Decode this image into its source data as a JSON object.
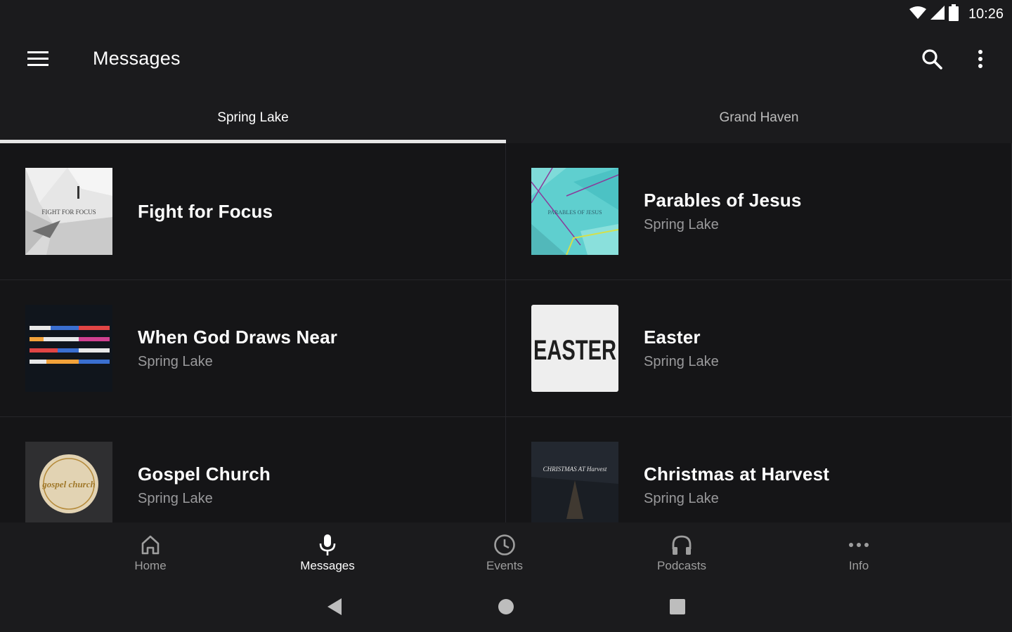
{
  "status_bar": {
    "time": "10:26"
  },
  "app_bar": {
    "title": "Messages"
  },
  "tabs": [
    {
      "label": "Spring Lake",
      "active": true
    },
    {
      "label": "Grand Haven",
      "active": false
    }
  ],
  "series": [
    {
      "title": "Fight for Focus",
      "subtitle": "",
      "art_text": "FIGHT FOR FOCUS"
    },
    {
      "title": "Parables of Jesus",
      "subtitle": "Spring Lake",
      "art_text": "PARABLES OF JESUS"
    },
    {
      "title": "When God Draws Near",
      "subtitle": "Spring Lake"
    },
    {
      "title": "Easter",
      "subtitle": "Spring Lake",
      "art_text": "EASTER"
    },
    {
      "title": "Gospel Church",
      "subtitle": "Spring Lake",
      "art_text": "gospel church"
    },
    {
      "title": "Christmas at Harvest",
      "subtitle": "Spring Lake",
      "art_text": "CHRISTMAS AT Harvest"
    }
  ],
  "bottom_nav": [
    {
      "label": "Home",
      "icon": "home-icon",
      "active": false
    },
    {
      "label": "Messages",
      "icon": "microphone-icon",
      "active": true
    },
    {
      "label": "Events",
      "icon": "clock-icon",
      "active": false
    },
    {
      "label": "Podcasts",
      "icon": "headphones-icon",
      "active": false
    },
    {
      "label": "Info",
      "icon": "more-horizontal-icon",
      "active": false
    }
  ],
  "colors": {
    "background": "#1b1b1d",
    "card_background": "#151517",
    "text_primary": "#ffffff",
    "text_secondary": "#9a9a9c",
    "tab_indicator": "#e6e6e6"
  }
}
